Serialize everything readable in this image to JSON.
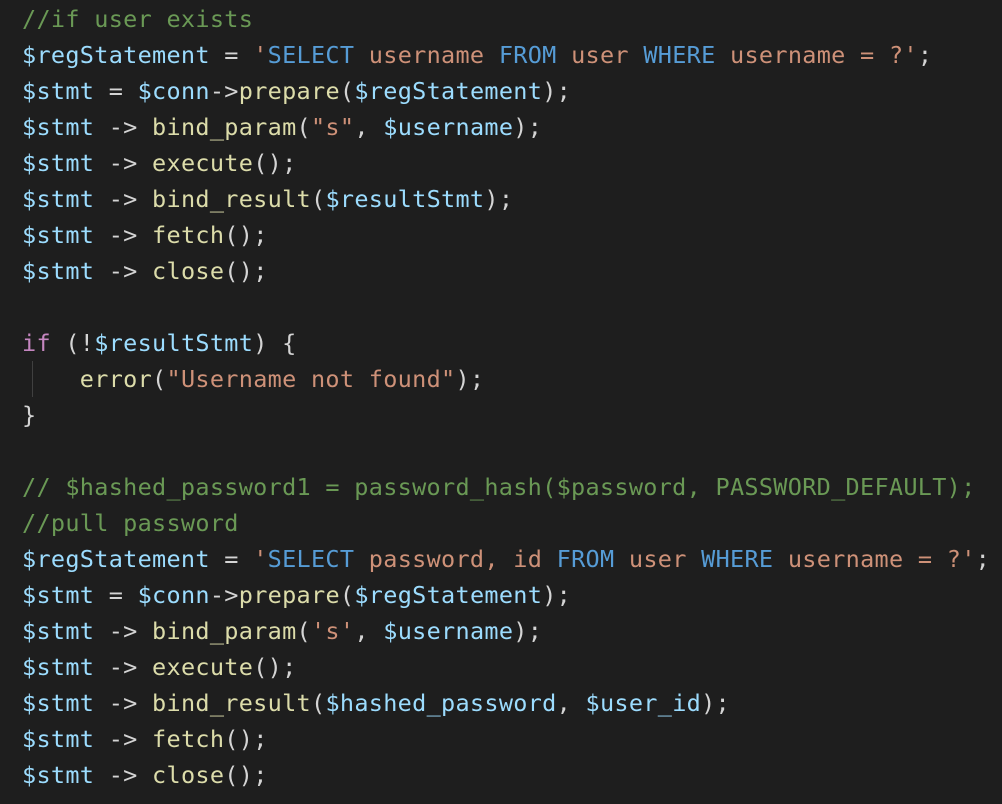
{
  "editor": {
    "theme_colors": {
      "background": "#1e1e1e",
      "default": "#d4d4d4",
      "comment": "#6a9955",
      "variable": "#9cdcfe",
      "function": "#dcdcaa",
      "string": "#ce9178",
      "keyword": "#c586c0",
      "sql_keyword": "#569cd6"
    },
    "lines": [
      [
        {
          "t": "//if user exists",
          "k": "comment"
        }
      ],
      [
        {
          "t": "$regStatement",
          "k": "var"
        },
        {
          "t": " = ",
          "k": "op"
        },
        {
          "t": "'",
          "k": "str"
        },
        {
          "t": "SELECT",
          "k": "sql"
        },
        {
          "t": " username ",
          "k": "str"
        },
        {
          "t": "FROM",
          "k": "sql"
        },
        {
          "t": " user ",
          "k": "str"
        },
        {
          "t": "WHERE",
          "k": "sql"
        },
        {
          "t": " username = ?'",
          "k": "str"
        },
        {
          "t": ";",
          "k": "op"
        }
      ],
      [
        {
          "t": "$stmt",
          "k": "var"
        },
        {
          "t": " = ",
          "k": "op"
        },
        {
          "t": "$conn",
          "k": "var"
        },
        {
          "t": "->",
          "k": "op"
        },
        {
          "t": "prepare",
          "k": "func"
        },
        {
          "t": "(",
          "k": "op"
        },
        {
          "t": "$regStatement",
          "k": "var"
        },
        {
          "t": ");",
          "k": "op"
        }
      ],
      [
        {
          "t": "$stmt",
          "k": "var"
        },
        {
          "t": " -> ",
          "k": "op"
        },
        {
          "t": "bind_param",
          "k": "func"
        },
        {
          "t": "(",
          "k": "op"
        },
        {
          "t": "\"s\"",
          "k": "str"
        },
        {
          "t": ", ",
          "k": "op"
        },
        {
          "t": "$username",
          "k": "var"
        },
        {
          "t": ");",
          "k": "op"
        }
      ],
      [
        {
          "t": "$stmt",
          "k": "var"
        },
        {
          "t": " -> ",
          "k": "op"
        },
        {
          "t": "execute",
          "k": "func"
        },
        {
          "t": "();",
          "k": "op"
        }
      ],
      [
        {
          "t": "$stmt",
          "k": "var"
        },
        {
          "t": " -> ",
          "k": "op"
        },
        {
          "t": "bind_result",
          "k": "func"
        },
        {
          "t": "(",
          "k": "op"
        },
        {
          "t": "$resultStmt",
          "k": "var"
        },
        {
          "t": ");",
          "k": "op"
        }
      ],
      [
        {
          "t": "$stmt",
          "k": "var"
        },
        {
          "t": " -> ",
          "k": "op"
        },
        {
          "t": "fetch",
          "k": "func"
        },
        {
          "t": "();",
          "k": "op"
        }
      ],
      [
        {
          "t": "$stmt",
          "k": "var"
        },
        {
          "t": " -> ",
          "k": "op"
        },
        {
          "t": "close",
          "k": "func"
        },
        {
          "t": "();",
          "k": "op"
        }
      ],
      [],
      [
        {
          "t": "if",
          "k": "kw"
        },
        {
          "t": " (!",
          "k": "op"
        },
        {
          "t": "$resultStmt",
          "k": "var"
        },
        {
          "t": ") {",
          "k": "op"
        }
      ],
      [
        {
          "t": "    ",
          "k": "op"
        },
        {
          "t": "error",
          "k": "func"
        },
        {
          "t": "(",
          "k": "op"
        },
        {
          "t": "\"Username not found\"",
          "k": "str"
        },
        {
          "t": ");",
          "k": "op"
        }
      ],
      [
        {
          "t": "}",
          "k": "op"
        }
      ],
      [],
      [
        {
          "t": "// $hashed_password1 = password_hash($password, PASSWORD_DEFAULT);",
          "k": "comment"
        }
      ],
      [
        {
          "t": "//pull password",
          "k": "comment"
        }
      ],
      [
        {
          "t": "$regStatement",
          "k": "var"
        },
        {
          "t": " = ",
          "k": "op"
        },
        {
          "t": "'",
          "k": "str"
        },
        {
          "t": "SELECT",
          "k": "sql"
        },
        {
          "t": " password, id ",
          "k": "str"
        },
        {
          "t": "FROM",
          "k": "sql"
        },
        {
          "t": " user ",
          "k": "str"
        },
        {
          "t": "WHERE",
          "k": "sql"
        },
        {
          "t": " username = ?'",
          "k": "str"
        },
        {
          "t": ";",
          "k": "op"
        }
      ],
      [
        {
          "t": "$stmt",
          "k": "var"
        },
        {
          "t": " = ",
          "k": "op"
        },
        {
          "t": "$conn",
          "k": "var"
        },
        {
          "t": "->",
          "k": "op"
        },
        {
          "t": "prepare",
          "k": "func"
        },
        {
          "t": "(",
          "k": "op"
        },
        {
          "t": "$regStatement",
          "k": "var"
        },
        {
          "t": ");",
          "k": "op"
        }
      ],
      [
        {
          "t": "$stmt",
          "k": "var"
        },
        {
          "t": " -> ",
          "k": "op"
        },
        {
          "t": "bind_param",
          "k": "func"
        },
        {
          "t": "(",
          "k": "op"
        },
        {
          "t": "'s'",
          "k": "str"
        },
        {
          "t": ", ",
          "k": "op"
        },
        {
          "t": "$username",
          "k": "var"
        },
        {
          "t": ");",
          "k": "op"
        }
      ],
      [
        {
          "t": "$stmt",
          "k": "var"
        },
        {
          "t": " -> ",
          "k": "op"
        },
        {
          "t": "execute",
          "k": "func"
        },
        {
          "t": "();",
          "k": "op"
        }
      ],
      [
        {
          "t": "$stmt",
          "k": "var"
        },
        {
          "t": " -> ",
          "k": "op"
        },
        {
          "t": "bind_result",
          "k": "func"
        },
        {
          "t": "(",
          "k": "op"
        },
        {
          "t": "$hashed_password",
          "k": "var"
        },
        {
          "t": ", ",
          "k": "op"
        },
        {
          "t": "$user_id",
          "k": "var"
        },
        {
          "t": ");",
          "k": "op"
        }
      ],
      [
        {
          "t": "$stmt",
          "k": "var"
        },
        {
          "t": " -> ",
          "k": "op"
        },
        {
          "t": "fetch",
          "k": "func"
        },
        {
          "t": "();",
          "k": "op"
        }
      ],
      [
        {
          "t": "$stmt",
          "k": "var"
        },
        {
          "t": " -> ",
          "k": "op"
        },
        {
          "t": "close",
          "k": "func"
        },
        {
          "t": "();",
          "k": "op"
        }
      ]
    ]
  }
}
